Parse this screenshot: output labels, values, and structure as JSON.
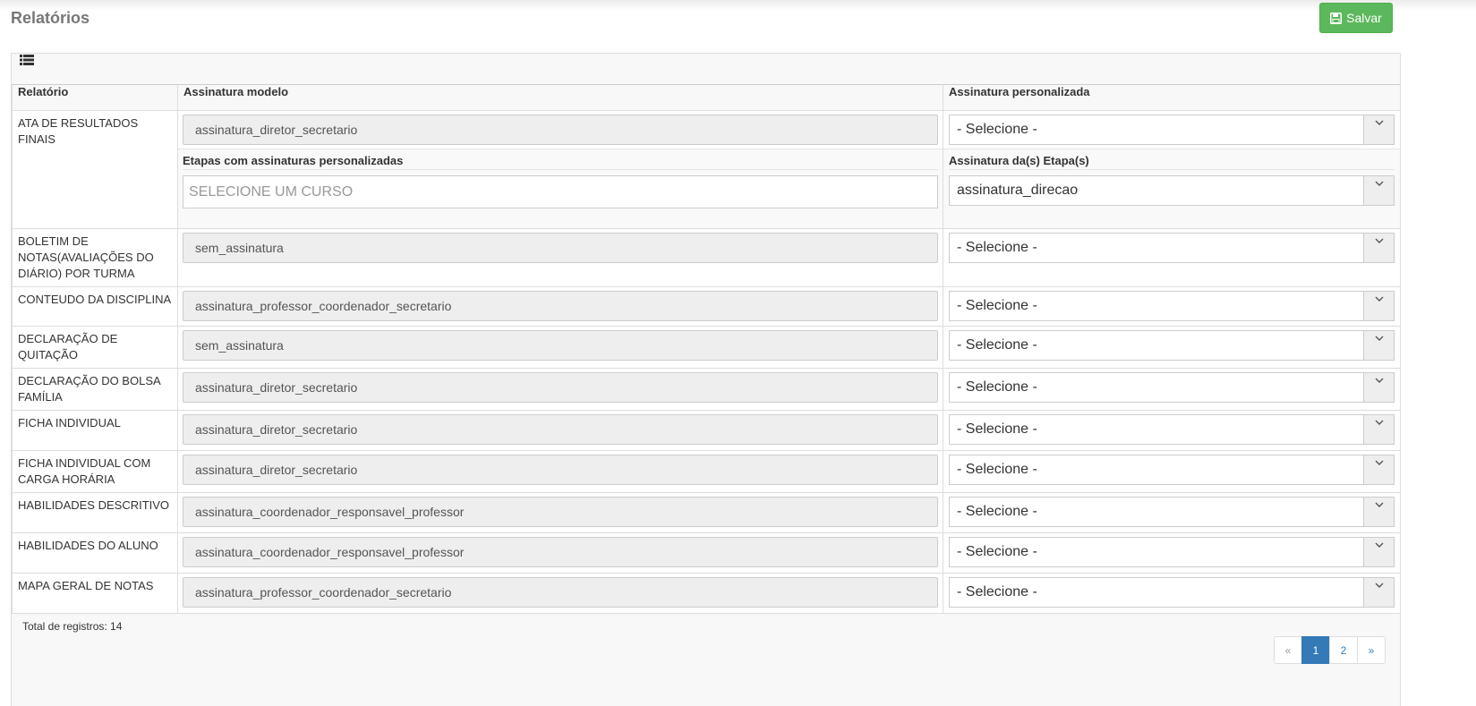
{
  "page": {
    "title": "Relatórios"
  },
  "toolbar": {
    "save_label": "Salvar"
  },
  "table": {
    "headers": {
      "report": "Relatório",
      "template": "Assinatura modelo",
      "custom": "Assinatura personalizada"
    },
    "rows": [
      {
        "name": "ATA DE RESULTADOS FINAIS",
        "template": "assinatura_diretor_secretario",
        "custom": "- Selecione -"
      },
      {
        "name": "BOLETIM DE NOTAS(AVALIAÇÕES DO DIÁRIO) POR TURMA",
        "template": "sem_assinatura",
        "custom": "- Selecione -"
      },
      {
        "name": "CONTEUDO DA DISCIPLINA",
        "template": "assinatura_professor_coordenador_secretario",
        "custom": "- Selecione -"
      },
      {
        "name": "DECLARAÇÃO DE QUITAÇÃO",
        "template": "sem_assinatura",
        "custom": "- Selecione -"
      },
      {
        "name": "DECLARAÇÃO DO BOLSA FAMÍLIA",
        "template": "assinatura_diretor_secretario",
        "custom": "- Selecione -"
      },
      {
        "name": "FICHA INDIVIDUAL",
        "template": "assinatura_diretor_secretario",
        "custom": "- Selecione -"
      },
      {
        "name": "FICHA INDIVIDUAL COM CARGA HORÁRIA",
        "template": "assinatura_diretor_secretario",
        "custom": "- Selecione -"
      },
      {
        "name": "HABILIDADES DESCRITIVO",
        "template": "assinatura_coordenador_responsavel_professor",
        "custom": "- Selecione -"
      },
      {
        "name": "HABILIDADES DO ALUNO",
        "template": "assinatura_coordenador_responsavel_professor",
        "custom": "- Selecione -"
      },
      {
        "name": "MAPA GERAL DE NOTAS",
        "template": "assinatura_professor_coordenador_secretario",
        "custom": "- Selecione -"
      }
    ],
    "stage_section": {
      "stages_label": "Etapas com assinaturas personalizadas",
      "stages_placeholder": "SELECIONE UM CURSO",
      "stage_signature_label": "Assinatura da(s) Etapa(s)",
      "stage_signature_value": "assinatura_direcao"
    }
  },
  "footer": {
    "total_text": "Total de registros: 14"
  },
  "pagination": {
    "prev": "«",
    "pages": [
      "1",
      "2"
    ],
    "current": "1",
    "next": "»"
  },
  "colors": {
    "save_button": "#5cb85c",
    "active_page": "#337ab7",
    "readonly_bg": "#eeeeee"
  },
  "icons": {
    "save": "floppy-disk-icon",
    "list": "list-icon",
    "dropdown": "chevron-down-icon"
  }
}
